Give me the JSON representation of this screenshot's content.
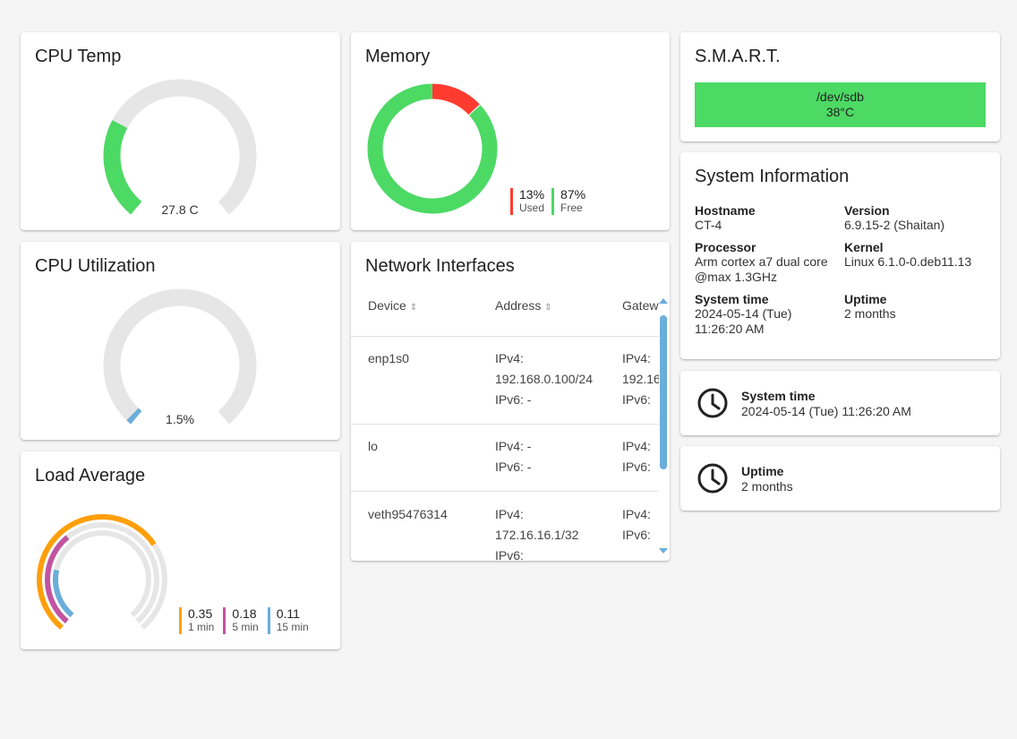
{
  "cpu_temp": {
    "title": "CPU Temp",
    "value_label": "27.8 C",
    "fraction": 0.278,
    "color": "#4cd964"
  },
  "cpu_util": {
    "title": "CPU Utilization",
    "value_label": "1.5%",
    "fraction": 0.015,
    "color": "#6aaedb"
  },
  "memory": {
    "title": "Memory",
    "used_fraction": 0.13,
    "used": {
      "value": "13%",
      "label": "Used",
      "color": "#ff3b30"
    },
    "free": {
      "value": "87%",
      "label": "Free",
      "color": "#4cd964"
    }
  },
  "load": {
    "title": "Load Average",
    "items": [
      {
        "value": "0.35",
        "label": "1 min",
        "color": "#ff9f0a",
        "fraction": 0.35
      },
      {
        "value": "0.18",
        "label": "5 min",
        "color": "#c254a1",
        "fraction": 0.18
      },
      {
        "value": "0.11",
        "label": "15 min",
        "color": "#6aaedb",
        "fraction": 0.11
      }
    ]
  },
  "network": {
    "title": "Network Interfaces",
    "columns": [
      "Device",
      "Address",
      "Gatew"
    ],
    "rows": [
      {
        "device": "enp1s0",
        "address": [
          "IPv4:",
          "192.168.0.100/24",
          "IPv6: -"
        ],
        "gateway": [
          "IPv4:",
          "192.16",
          "IPv6:"
        ]
      },
      {
        "device": "lo",
        "address": [
          "IPv4: -",
          "IPv6: -"
        ],
        "gateway": [
          "IPv4:",
          "IPv6:"
        ]
      },
      {
        "device": "veth95476314",
        "address": [
          "IPv4:",
          "172.16.16.1/32",
          "IPv6:"
        ],
        "gateway": [
          "IPv4:",
          "IPv6:"
        ]
      }
    ]
  },
  "smart": {
    "title": "S.M.A.R.T.",
    "device": "/dev/sdb",
    "temp": "38°C",
    "color": "#4cd964"
  },
  "sysinfo": {
    "title": "System Information",
    "hostname_label": "Hostname",
    "hostname": "CT-4",
    "version_label": "Version",
    "version": "6.9.15-2 (Shaitan)",
    "processor_label": "Processor",
    "processor_1": "Arm cortex a7 dual core",
    "processor_2": "@max 1.3GHz",
    "kernel_label": "Kernel",
    "kernel": "Linux 6.1.0-0.deb11.13",
    "systime_label": "System time",
    "systime_1": "2024-05-14 (Tue)",
    "systime_2": "11:26:20 AM",
    "uptime_label": "Uptime",
    "uptime": "2 months"
  },
  "time_card": {
    "title": "System time",
    "value": "2024-05-14 (Tue) 11:26:20 AM"
  },
  "uptime_card": {
    "title": "Uptime",
    "value": "2 months"
  }
}
